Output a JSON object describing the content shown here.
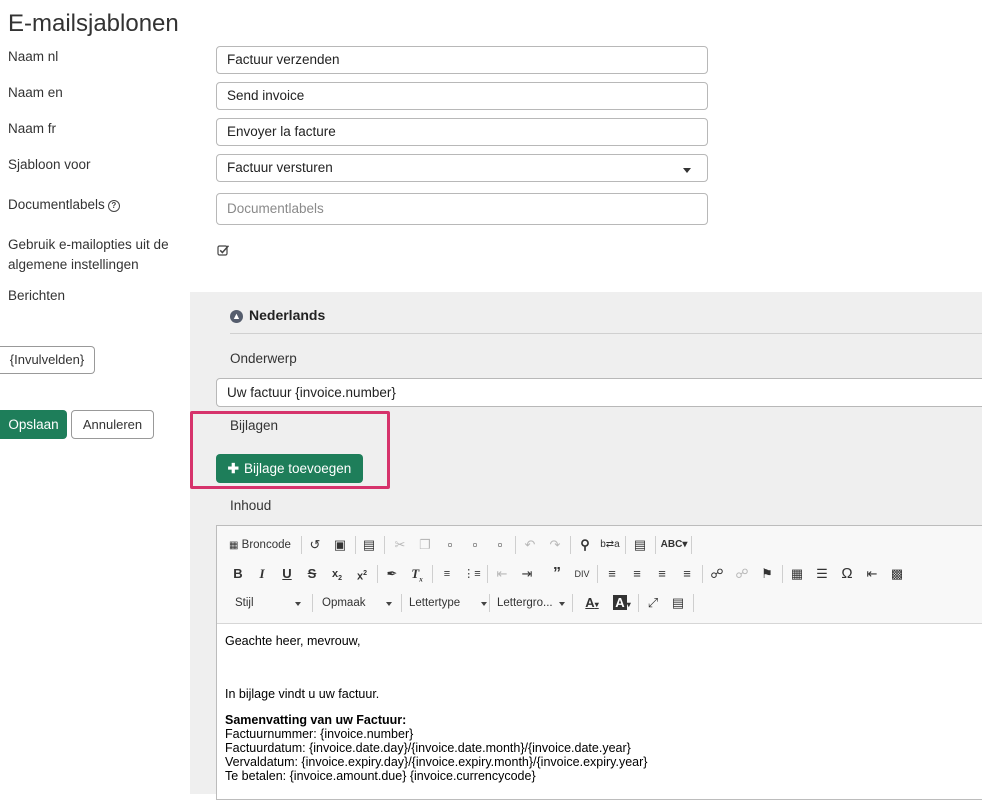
{
  "page": {
    "title": "E-mailsjablonen"
  },
  "form": {
    "naam_nl": {
      "label": "Naam nl",
      "value": "Factuur verzenden"
    },
    "naam_en": {
      "label": "Naam en",
      "value": "Send invoice"
    },
    "naam_fr": {
      "label": "Naam fr",
      "value": "Envoyer la facture"
    },
    "sjabloon": {
      "label": "Sjabloon voor",
      "value": "Factuur versturen"
    },
    "documentlabels": {
      "label": "Documentlabels",
      "placeholder": "Documentlabels"
    },
    "email_options": {
      "label_line1": "Gebruik e-mailopties uit de",
      "label_line2": "algemene instellingen",
      "checked": true
    },
    "berichten": {
      "label": "Berichten"
    }
  },
  "sidebar_buttons": {
    "invulvelden": "{Invulvelden}",
    "save": "Opslaan",
    "cancel": "Annuleren"
  },
  "message": {
    "language_heading": "Nederlands",
    "subject_label": "Onderwerp",
    "subject_value": "Uw factuur {invoice.number}",
    "attachments_label": "Bijlagen",
    "add_attachment": "Bijlage toevoegen",
    "content_label": "Inhoud"
  },
  "editor": {
    "source_label": "Broncode",
    "combos": {
      "style": "Stijl",
      "format": "Opmaak",
      "font": "Lettertype",
      "size": "Lettergro..."
    },
    "body": {
      "greeting": "Geachte heer, mevrouw,",
      "intro": "In bijlage vindt u uw factuur.",
      "summary_title": "Samenvatting van uw Factuur:",
      "lines": [
        "Factuurnummer: {invoice.number}",
        "Factuurdatum: {invoice.date.day}/{invoice.date.month}/{invoice.date.year}",
        "Vervaldatum: {invoice.expiry.day}/{invoice.expiry.month}/{invoice.expiry.year}",
        "Te betalen: {invoice.amount.due} {invoice.currencycode}"
      ]
    }
  },
  "colors": {
    "primary_green": "#1e7e5a",
    "highlight": "#d6336c",
    "panel_gray": "#efefef"
  }
}
